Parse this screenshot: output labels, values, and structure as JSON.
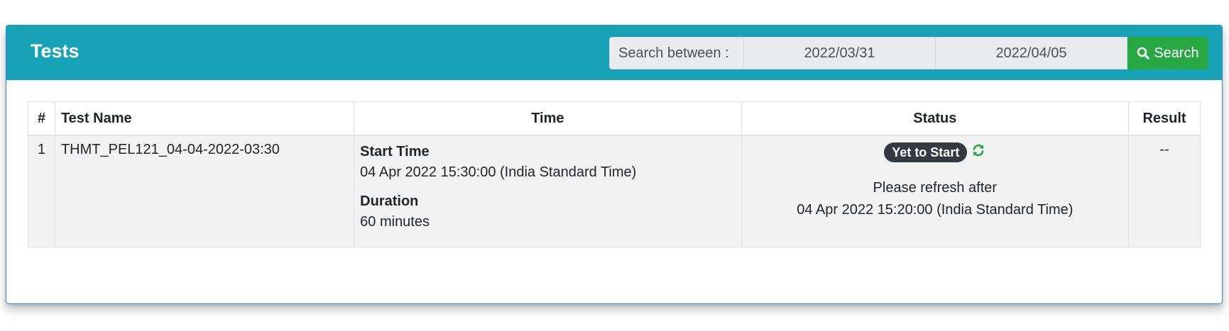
{
  "header": {
    "title": "Tests"
  },
  "search": {
    "label": "Search between :",
    "from_date": "2022/03/31",
    "to_date": "2022/04/05",
    "button_label": "Search",
    "button_icon": "search-icon"
  },
  "table": {
    "columns": [
      "#",
      "Test Name",
      "Time",
      "Status",
      "Result"
    ],
    "rows": [
      {
        "num": "1",
        "name": "THMT_PEL121_04-04-2022-03:30",
        "start_time_label": "Start Time",
        "start_time_value": "04 Apr 2022 15:30:00 (India Standard Time)",
        "duration_label": "Duration",
        "duration_value": "60 minutes",
        "status_badge": "Yet to Start",
        "status_icon": "refresh-icon",
        "refresh_note": "Please refresh after",
        "refresh_time": "04 Apr 2022 15:20:00 (India Standard Time)",
        "result": "--"
      }
    ]
  },
  "colors": {
    "header_bg": "#17a2b8",
    "search_button": "#28a745",
    "badge_bg": "#343a40",
    "refresh_icon": "#28a745",
    "row_bg": "#f2f2f2",
    "card_border": "#2f8fd0"
  }
}
